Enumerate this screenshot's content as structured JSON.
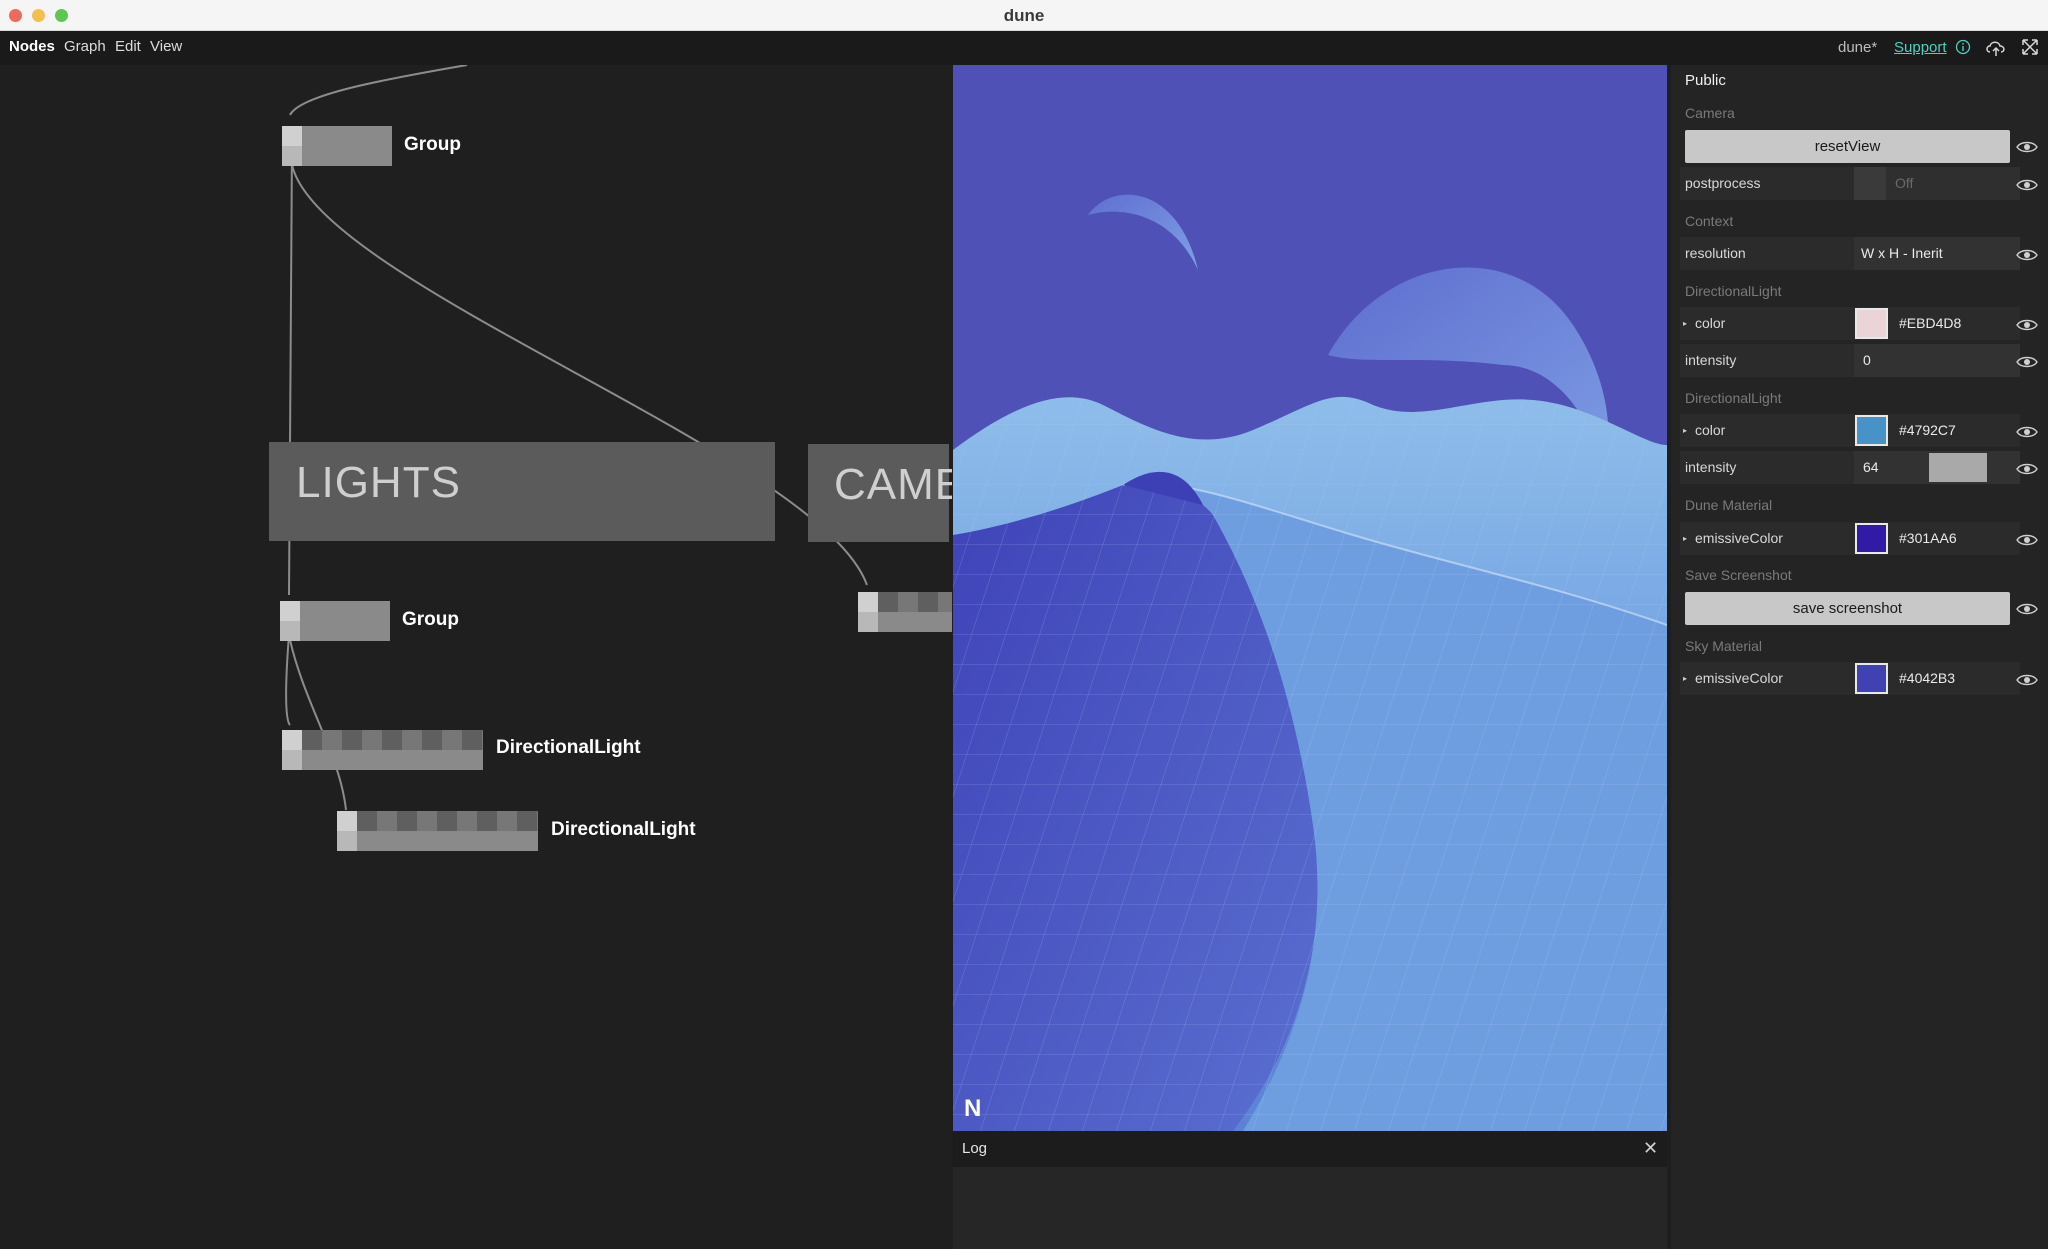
{
  "window": {
    "title": "dune"
  },
  "menubar": {
    "items": [
      "Nodes",
      "Graph",
      "Edit",
      "View"
    ],
    "project_name": "dune*",
    "support_label": "Support"
  },
  "graph": {
    "nodes": [
      {
        "label": "Group"
      },
      {
        "label": "Group"
      },
      {
        "label": "DirectionalLight"
      },
      {
        "label": "DirectionalLight"
      }
    ],
    "comments": [
      {
        "label": "LIGHTS"
      },
      {
        "label": "CAME"
      }
    ]
  },
  "viewport": {
    "logo": "N",
    "sky_color": "#4F51B6",
    "dune_color": "#7BA8E0"
  },
  "log": {
    "title": "Log"
  },
  "inspector": {
    "title": "Public",
    "sections": {
      "camera": "Camera",
      "context": "Context",
      "dirlight1": "DirectionalLight",
      "dirlight2": "DirectionalLight",
      "dune_material": "Dune Material",
      "save_screenshot": "Save Screenshot",
      "sky_material": "Sky Material"
    },
    "reset_view_label": "resetView",
    "postprocess": {
      "label": "postprocess",
      "value": "Off"
    },
    "resolution": {
      "label": "resolution",
      "value": "W x H - Inerit"
    },
    "dirlight1_color": {
      "label": "color",
      "value": "#EBD4D8",
      "swatch": "#EBD4D8"
    },
    "dirlight1_intensity": {
      "label": "intensity",
      "value": "0"
    },
    "dirlight2_color": {
      "label": "color",
      "value": "#4792C7",
      "swatch": "#4792C7"
    },
    "dirlight2_intensity": {
      "label": "intensity",
      "value": "64"
    },
    "dune_emissive": {
      "label": "emissiveColor",
      "value": "#301AA6",
      "swatch": "#301AA6"
    },
    "save_screenshot_label": "save screenshot",
    "sky_emissive": {
      "label": "emissiveColor",
      "value": "#4042B3",
      "swatch": "#4042B3"
    }
  }
}
